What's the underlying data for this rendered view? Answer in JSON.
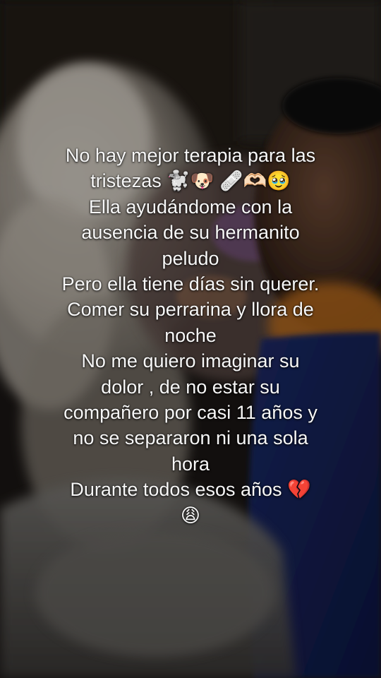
{
  "caption": {
    "lines": [
      "No hay mejor terapia para las",
      "tristezas 🐩🐶 🩹🫶🏻🥹",
      "Ella ayudándome con la",
      "ausencia de su hermanito",
      "peludo",
      "Pero ella tiene días sin querer.",
      "Comer su perrarina y llora de",
      "noche",
      "No me quiero imaginar su",
      "dolor , de no estar su",
      "compañero por casi 11 años y",
      "no se separaron ni una sola",
      "hora",
      "Durante todos esos años 💔",
      "😩"
    ]
  },
  "colors": {
    "caption_text": "#f7f7f7",
    "background": "#0c0b0a"
  }
}
